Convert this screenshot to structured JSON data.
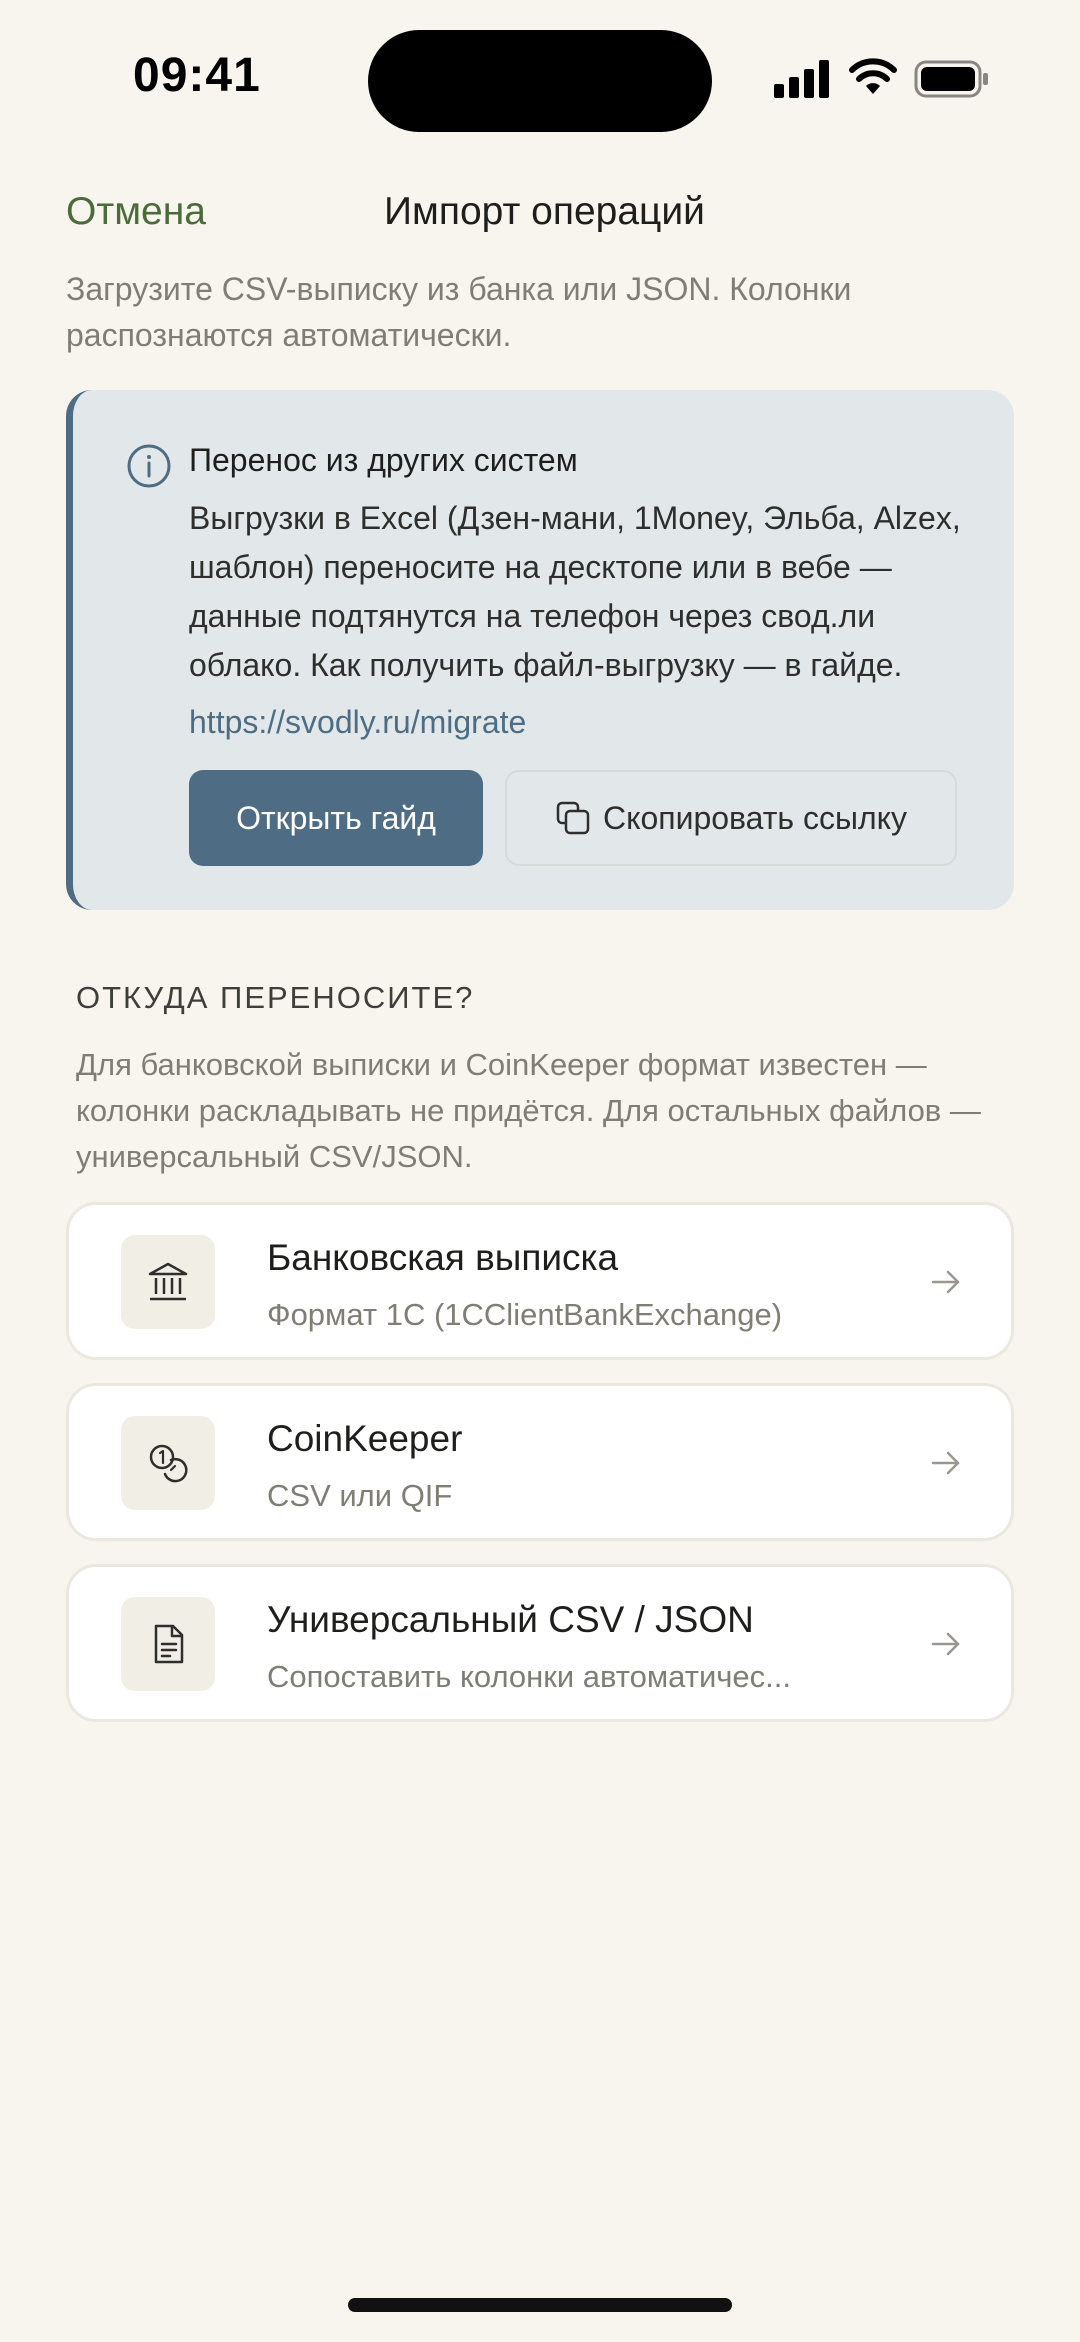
{
  "status_bar": {
    "time": "09:41"
  },
  "header": {
    "cancel_label": "Отмена",
    "title": "Импорт операций",
    "subtitle": "Загрузите CSV-выписку из банка или JSON. Колонки распознаются автоматически."
  },
  "info_card": {
    "icon": "info-icon",
    "title": "Перенос из других систем",
    "body": "Выгрузки в Excel (Дзен-мани, 1Money, Эльба, Alzex, шаблон) переносите на десктопе или в вебе — данные подтянутся на телефон через свод.ли облако. Как получить файл-выгрузку — в гайде.",
    "link": "https://svodly.ru/migrate",
    "open_guide_label": "Открыть гайд",
    "copy_link_label": "Скопировать ссылку"
  },
  "section": {
    "heading": "ОТКУДА ПЕРЕНОСИТЕ?",
    "description": "Для банковской выписки и CoinKeeper формат известен — колонки раскладывать не придётся. Для остальных файлов — универсальный CSV/JSON."
  },
  "options": [
    {
      "icon": "bank-icon",
      "title": "Банковская выписка",
      "subtitle": "Формат 1С (1CClientBankExchange)"
    },
    {
      "icon": "coins-icon",
      "title": "CoinKeeper",
      "subtitle": "CSV или QIF"
    },
    {
      "icon": "document-icon",
      "title": "Универсальный CSV / JSON",
      "subtitle": "Сопоставить колонки автоматичес..."
    }
  ],
  "colors": {
    "background": "#f7f5ee",
    "accent_green": "#4b6b3a",
    "accent_blue": "#4e6d85",
    "info_card_bg": "#e2e8ea"
  }
}
